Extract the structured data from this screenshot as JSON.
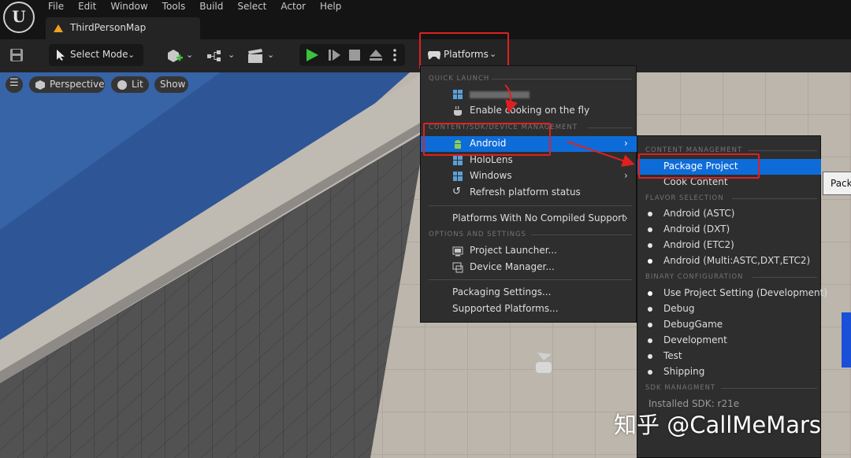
{
  "menubar": {
    "items": [
      "File",
      "Edit",
      "Window",
      "Tools",
      "Build",
      "Select",
      "Actor",
      "Help"
    ],
    "logo_text": "U"
  },
  "tab": {
    "title": "ThirdPersonMap",
    "icon": "map-icon"
  },
  "toolbar": {
    "select_mode_label": "Select Mode",
    "platforms_label": "Platforms"
  },
  "viewport": {
    "perspective_label": "Perspective",
    "lit_label": "Lit",
    "show_label": "Show"
  },
  "platforms_menu": {
    "quick_launch_header": "QUICK LAUNCH",
    "quick_launch_device": "",
    "enable_cooking": "Enable cooking on the fly",
    "sdk_header": "CONTENT/SDK/DEVICE MANAGEMENT",
    "android": "Android",
    "hololens": "HoloLens",
    "windows": "Windows",
    "refresh": "Refresh platform status",
    "no_compiled": "Platforms With No Compiled Support",
    "options_header": "OPTIONS AND SETTINGS",
    "project_launcher": "Project Launcher...",
    "device_manager": "Device Manager...",
    "packaging_settings": "Packaging Settings...",
    "supported_platforms": "Supported Platforms..."
  },
  "android_submenu": {
    "content_header": "CONTENT MANAGEMENT",
    "package_project": "Package Project",
    "cook_content": "Cook Content",
    "flavor_header": "FLAVOR SELECTION",
    "flavors": [
      "Android (ASTC)",
      "Android (DXT)",
      "Android (ETC2)",
      "Android (Multi:ASTC,DXT,ETC2)"
    ],
    "binary_header": "BINARY CONFIGURATION",
    "configs": [
      "Use Project Setting (Development)",
      "Debug",
      "DebugGame",
      "Development",
      "Test",
      "Shipping"
    ],
    "sdk_header": "SDK MANAGMENT",
    "installed_sdk": "Installed SDK: r21e"
  },
  "tooltip": {
    "text": "Packa"
  },
  "watermark": "知乎 @CallMeMars",
  "colors": {
    "highlight_blue": "#0e6cd9",
    "annotation_red": "#e02020",
    "menu_bg": "#2e2e2e",
    "toolbar_bg": "#242424",
    "play_green": "#3cc23c"
  }
}
